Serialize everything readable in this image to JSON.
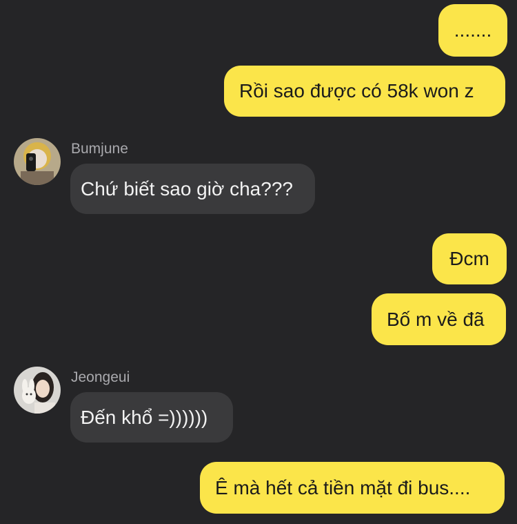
{
  "messages": [
    {
      "id": "m1",
      "from": "me",
      "text": "......."
    },
    {
      "id": "m2",
      "from": "me",
      "text": "Rồi sao được có 58k won z"
    },
    {
      "id": "m3",
      "from": "them",
      "sender": "Bumjune",
      "avatar": "avatar-icon",
      "text": "Chứ biết sao giờ cha???"
    },
    {
      "id": "m4",
      "from": "me",
      "text": "Đcm"
    },
    {
      "id": "m5",
      "from": "me",
      "text": "Bố m về đã"
    },
    {
      "id": "m6",
      "from": "them",
      "sender": "Jeongeui",
      "avatar": "avatar-icon",
      "text": "Đến khổ =))))))"
    },
    {
      "id": "m7",
      "from": "me",
      "text": "Ê mà hết cả tiền mặt đi bus...."
    }
  ],
  "colors": {
    "background": "#252527",
    "my_bubble": "#fbe54a",
    "their_bubble": "#3a3a3c"
  }
}
